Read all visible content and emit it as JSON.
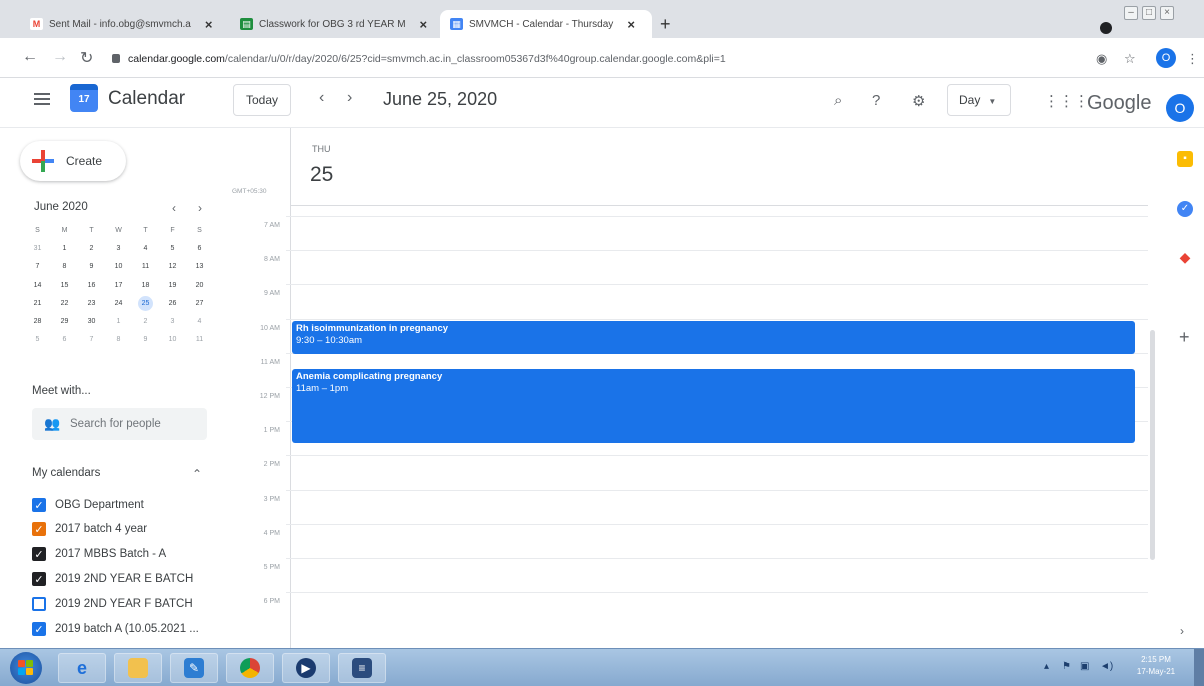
{
  "browser": {
    "tabs": [
      {
        "title": "Sent Mail - info.obg@smvmch.a",
        "icon": "gmail-icon"
      },
      {
        "title": "Classwork for OBG 3 rd YEAR M",
        "icon": "classroom-icon"
      },
      {
        "title": "SMVMCH - Calendar - Thursday",
        "icon": "calendar-icon"
      }
    ],
    "new_tab": "+",
    "url_host": "calendar.google.com",
    "url_path": "/calendar/u/0/r/day/2020/6/25?cid=smvmch.ac.in_classroom05367d3f%40group.calendar.google.com&pli=1",
    "profile_initial": "O"
  },
  "header": {
    "app_title": "Calendar",
    "logo_text": "17",
    "today_label": "Today",
    "date_title": "June 25, 2020",
    "view_label": "Day",
    "google_word": "Google",
    "avatar_initial": "O"
  },
  "sidebar": {
    "create_label": "Create",
    "mini_month": "June 2020",
    "weekday_heads": [
      "S",
      "M",
      "T",
      "W",
      "T",
      "F",
      "S"
    ],
    "weeks": [
      [
        "31",
        "1",
        "2",
        "3",
        "4",
        "5",
        "6"
      ],
      [
        "7",
        "8",
        "9",
        "10",
        "11",
        "12",
        "13"
      ],
      [
        "14",
        "15",
        "16",
        "17",
        "18",
        "19",
        "20"
      ],
      [
        "21",
        "22",
        "23",
        "24",
        "25",
        "26",
        "27"
      ],
      [
        "28",
        "29",
        "30",
        "1",
        "2",
        "3",
        "4"
      ],
      [
        "5",
        "6",
        "7",
        "8",
        "9",
        "10",
        "11"
      ]
    ],
    "selected_day": "25",
    "meet_title": "Meet with...",
    "search_people_placeholder": "Search for people",
    "my_calendars_title": "My calendars",
    "calendars": [
      {
        "name": "OBG Department",
        "checked": true,
        "color": "#1a73e8"
      },
      {
        "name": "2017 batch 4 year",
        "checked": true,
        "color": "#e8710a"
      },
      {
        "name": "2017 MBBS Batch - A",
        "checked": true,
        "color": "#202124"
      },
      {
        "name": "2019 2ND YEAR E BATCH",
        "checked": true,
        "color": "#202124"
      },
      {
        "name": "2019 2ND YEAR F BATCH",
        "checked": false,
        "color": "#1a73e8"
      },
      {
        "name": "2019 batch A (10.05.2021 ...",
        "checked": true,
        "color": "#1a73e8"
      }
    ]
  },
  "day_view": {
    "weekday": "THU",
    "day_number": "25",
    "timezone": "GMT+05:30",
    "hours": [
      "7 AM",
      "8 AM",
      "9 AM",
      "10 AM",
      "11 AM",
      "12 PM",
      "1 PM",
      "2 PM",
      "3 PM",
      "4 PM",
      "5 PM",
      "6 PM"
    ],
    "events": [
      {
        "title": "Rh isoimmunization in pregnancy",
        "time": "9:30 – 10:30am"
      },
      {
        "title": "Anemia complicating pregnancy",
        "time": "11am – 1pm"
      }
    ]
  },
  "taskbar": {
    "clock_time": "2:15 PM",
    "clock_date": "17-May-21"
  }
}
